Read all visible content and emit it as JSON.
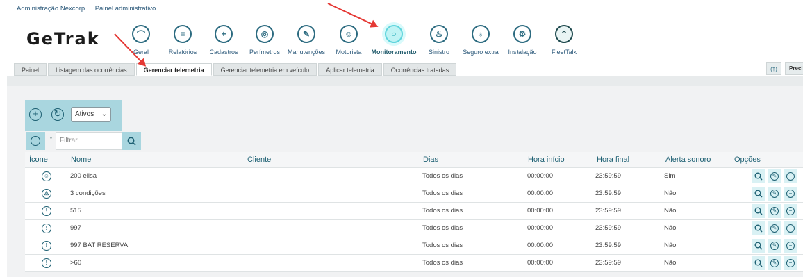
{
  "breadcrumb": {
    "org": "Administração Nexcorp",
    "page": "Painel administrativo"
  },
  "logo": "GeTrak",
  "modules": [
    {
      "label": "Geral",
      "icon": "monitor-icon",
      "glyph": "⌒"
    },
    {
      "label": "Relatórios",
      "icon": "report-icon",
      "glyph": "≡"
    },
    {
      "label": "Cadastros",
      "icon": "folder-plus-icon",
      "glyph": "+"
    },
    {
      "label": "Perímetros",
      "icon": "perimeter-icon",
      "glyph": "◎"
    },
    {
      "label": "Manutenções",
      "icon": "wrench-icon",
      "glyph": "✎"
    },
    {
      "label": "Motorista",
      "icon": "driver-icon",
      "glyph": "☺"
    },
    {
      "label": "Monitoramento",
      "icon": "monitoring-icon",
      "glyph": "○"
    },
    {
      "label": "Sinistro",
      "icon": "alarm-icon",
      "glyph": "♨"
    },
    {
      "label": "Seguro extra",
      "icon": "shield-keyhole-icon",
      "glyph": "♁"
    },
    {
      "label": "Instalação",
      "icon": "install-icon",
      "glyph": "⚙"
    },
    {
      "label": "FleetTalk",
      "icon": "fleettalk-icon",
      "glyph": "⌃"
    }
  ],
  "tabs": [
    "Painel",
    "Listagem das ocorrências",
    "Gerenciar telemetria",
    "Gerenciar telemetria em veículo",
    "Aplicar telemetria",
    "Ocorrências tratadas"
  ],
  "right_tools": {
    "antenna": "(†)",
    "partial_label": "Preci"
  },
  "toolbar": {
    "status_select": "Ativos"
  },
  "filter": {
    "placeholder": "Filtrar"
  },
  "table": {
    "headers": [
      "Ícone",
      "Nome",
      "Cliente",
      "Dias",
      "Hora início",
      "Hora final",
      "Alerta sonoro",
      "Opções"
    ],
    "rows": [
      {
        "icon": "person-badge-icon",
        "glyph": "☺",
        "nome": "200 elisa",
        "cliente": "",
        "dias": "Todos os dias",
        "inicio": "00:00:00",
        "final": "23:59:59",
        "alerta": "Sim"
      },
      {
        "icon": "warning-triangle-icon",
        "glyph": "⚠",
        "nome": "3 condições",
        "cliente": "",
        "dias": "Todos os dias",
        "inicio": "00:00:00",
        "final": "23:59:59",
        "alerta": "Não"
      },
      {
        "icon": "exclamation-circle-icon",
        "glyph": "!",
        "nome": "515",
        "cliente": "",
        "dias": "Todos os dias",
        "inicio": "00:00:00",
        "final": "23:59:59",
        "alerta": "Não"
      },
      {
        "icon": "exclamation-circle-icon",
        "glyph": "!",
        "nome": "997",
        "cliente": "",
        "dias": "Todos os dias",
        "inicio": "00:00:00",
        "final": "23:59:59",
        "alerta": "Não"
      },
      {
        "icon": "exclamation-circle-icon",
        "glyph": "!",
        "nome": "997 BAT RESERVA",
        "cliente": "",
        "dias": "Todos os dias",
        "inicio": "00:00:00",
        "final": "23:59:59",
        "alerta": "Não"
      },
      {
        "icon": "exclamation-circle-icon",
        "glyph": "!",
        "nome": ">60",
        "cliente": "",
        "dias": "Todos os dias",
        "inicio": "00:00:00",
        "final": "23:59:59",
        "alerta": "Não"
      }
    ]
  },
  "colors": {
    "accent": "#1c5f72",
    "toolbar_bg": "#a9d6df",
    "active_ring": "#5fd4dc",
    "annotation_arrow": "#e53935"
  }
}
